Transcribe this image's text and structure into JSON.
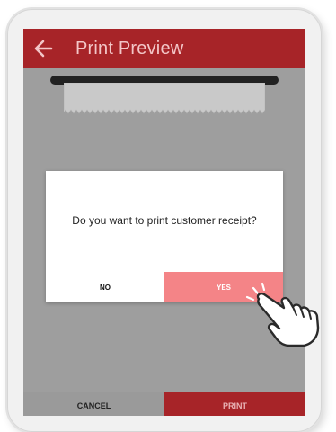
{
  "header": {
    "title": "Print Preview",
    "back_icon": "arrow-left-icon"
  },
  "dialog": {
    "message": "Do you want to print customer receipt?",
    "no_label": "NO",
    "yes_label": "YES"
  },
  "footer": {
    "cancel_label": "CANCEL",
    "print_label": "PRINT"
  },
  "colors": {
    "brand": "#a72428",
    "yes_button": "#f48487",
    "overlay": "#9e9e9e"
  },
  "icons": {
    "pointer": "pointing-hand-icon"
  }
}
